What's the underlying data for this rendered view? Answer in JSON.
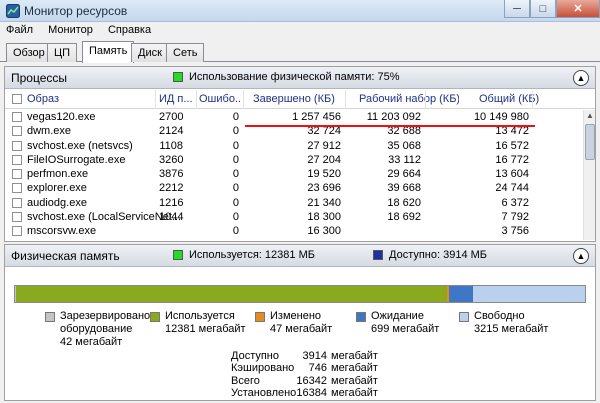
{
  "window": {
    "title": "Монитор ресурсов"
  },
  "menu": [
    "Файл",
    "Монитор",
    "Справка"
  ],
  "tabs": [
    {
      "label": "Обзор",
      "active": false
    },
    {
      "label": "ЦП",
      "active": false
    },
    {
      "label": "Память",
      "active": true
    },
    {
      "label": "Диск",
      "active": false
    },
    {
      "label": "Сеть",
      "active": false
    }
  ],
  "processes": {
    "title": "Процессы",
    "usage_label": "Использование физической памяти: 75%",
    "usage_color": "#22dd22",
    "columns": [
      "Образ",
      "ИД п...",
      "Ошибо...",
      "Завершено (КБ)",
      "Рабочий набор (КБ)",
      "Общий (КБ)"
    ],
    "rows": [
      {
        "image": "vegas120.exe",
        "pid": "2700",
        "faults": "0",
        "commit": "1 257 456",
        "working": "11 203 092",
        "shareable": "10 149 980"
      },
      {
        "image": "dwm.exe",
        "pid": "2124",
        "faults": "0",
        "commit": "32 724",
        "working": "32 688",
        "shareable": "13 472"
      },
      {
        "image": "svchost.exe (netsvcs)",
        "pid": "1108",
        "faults": "0",
        "commit": "27 912",
        "working": "35 068",
        "shareable": "16 572"
      },
      {
        "image": "FileIOSurrogate.exe",
        "pid": "3260",
        "faults": "0",
        "commit": "27 204",
        "working": "33 112",
        "shareable": "16 772"
      },
      {
        "image": "perfmon.exe",
        "pid": "3876",
        "faults": "0",
        "commit": "19 520",
        "working": "29 664",
        "shareable": "13 604"
      },
      {
        "image": "explorer.exe",
        "pid": "2212",
        "faults": "0",
        "commit": "23 696",
        "working": "39 668",
        "shareable": "24 744"
      },
      {
        "image": "audiodg.exe",
        "pid": "1216",
        "faults": "0",
        "commit": "21 340",
        "working": "18 620",
        "shareable": "6 372"
      },
      {
        "image": "svchost.exe (LocalServiceNet...",
        "pid": "1044",
        "faults": "0",
        "commit": "18 300",
        "working": "18 692",
        "shareable": "7 792"
      },
      {
        "image": "mscorsvw.exe",
        "pid": "",
        "faults": "0",
        "commit": "16 300",
        "working": "",
        "shareable": "3 756"
      }
    ]
  },
  "physical": {
    "title": "Физическая память",
    "used_label": "Используется: 12381 МБ",
    "used_color": "#22dd22",
    "avail_label": "Доступно: 3914 МБ",
    "avail_color": "#1f2fa8",
    "bar_fractions": {
      "reserved": 0.0026,
      "used": 0.7576,
      "modified": 0.0029,
      "standby": 0.0428,
      "free": 0.1967
    },
    "legend": [
      {
        "l1": "Зарезервировано",
        "l2": "оборудование",
        "l3": "42 мегабайт",
        "color": "#c4c4c4"
      },
      {
        "l1": "Используется",
        "l2": "12381 мегабайт",
        "l3": "",
        "color": "#8aa91e"
      },
      {
        "l1": "Изменено",
        "l2": "47 мегабайт",
        "l3": "",
        "color": "#e6891e"
      },
      {
        "l1": "Ожидание",
        "l2": "699 мегабайт",
        "l3": "",
        "color": "#3e77c6"
      },
      {
        "l1": "Свободно",
        "l2": "3215 мегабайт",
        "l3": "",
        "color": "#b9d1ec"
      }
    ],
    "stats": [
      {
        "label": "Доступно",
        "value": "3914",
        "unit": "мегабайт"
      },
      {
        "label": "Кэшировано",
        "value": "746",
        "unit": "мегабайт"
      },
      {
        "label": "Всего",
        "value": "16342",
        "unit": "мегабайт"
      },
      {
        "label": "Установлено",
        "value": "16384",
        "unit": "мегабайт"
      }
    ]
  }
}
